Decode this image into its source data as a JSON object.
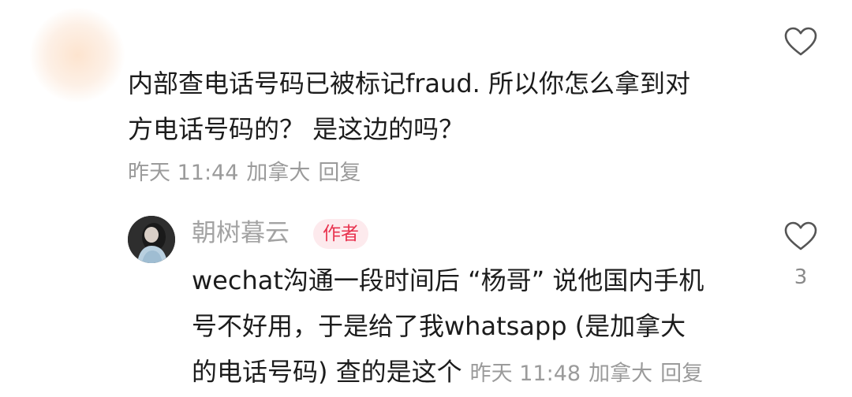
{
  "comment1": {
    "text_line1": "内部查电话号码已被标记fraud. 所以你怎么拿到对",
    "text_line2": "方电话号码的？ 是这边的吗？",
    "time": "昨天 11:44",
    "location": "加拿大",
    "reply_label": "回复"
  },
  "reply1": {
    "username": "朝树暮云",
    "badge": "作者",
    "text_line1": "wechat沟通一段时间后 “杨哥” 说他国内手机",
    "text_line2": "号不好用，于是给了我whatsapp (是加拿大",
    "text_line3": "的电话号码) 查的是这个",
    "time": "昨天 11:48",
    "location": "加拿大",
    "reply_label": "回复",
    "like_count": "3"
  },
  "icons": {
    "like": "heart-outline-icon"
  },
  "colors": {
    "text": "#1c1c1c",
    "meta": "#9b9b9b",
    "badge_text": "#e8334f",
    "badge_bg": "#fdeaed",
    "like_outline": "#555555"
  }
}
